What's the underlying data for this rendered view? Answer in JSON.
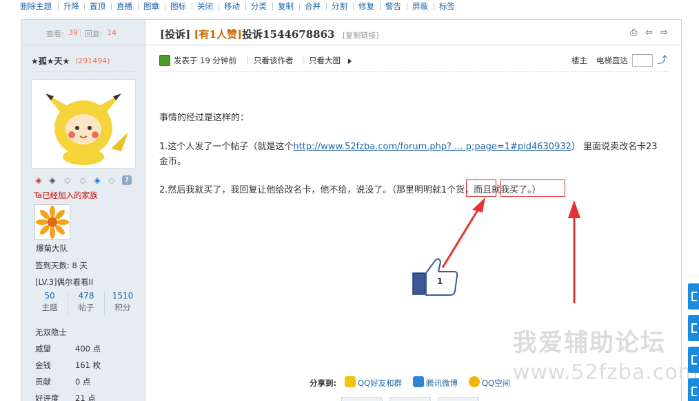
{
  "admin_bar": {
    "items": [
      "删除主题",
      "升降",
      "置顶",
      "直播",
      "图章",
      "图标",
      "关闭",
      "移动",
      "分类",
      "复制",
      "合并",
      "分割",
      "修复",
      "警告",
      "屏蔽",
      "标签"
    ]
  },
  "sidebar": {
    "views_label": "查看:",
    "views_value": "39",
    "replies_label": "回复:",
    "replies_value": "14",
    "author_name": "★孤★天★",
    "author_uid": "(291494)",
    "medals": [
      "medal-icon-red",
      "medal-icon-dark",
      "medal-icon-gray",
      "medal-icon-gray",
      "medal-icon-blue",
      "medal-icon-gray",
      "help-icon"
    ],
    "family_link": "Ta已经加入的家族",
    "family_name": "爆菊大队",
    "checkin_days": "签到天数: 8 天",
    "level": "[LV.3]偶尔看看II",
    "stats": [
      {
        "value": "50",
        "label": "主题"
      },
      {
        "value": "478",
        "label": "帖子"
      },
      {
        "value": "1510",
        "label": "积分"
      }
    ],
    "title": "无双隐士",
    "kv": [
      {
        "label": "威望",
        "value": "400 点"
      },
      {
        "label": "金钱",
        "value": "161 枚"
      },
      {
        "label": "贡献",
        "value": "0 点"
      },
      {
        "label": "好评度",
        "value": "21 点"
      }
    ]
  },
  "post": {
    "category": "[投诉]",
    "badge": "[有1人赞]",
    "title": "投诉1544678863",
    "copy_link": "[复制链接]",
    "meta": {
      "posted": "发表于 19 分钟前",
      "only_author": "只看该作者",
      "big_image": "只看大图",
      "floor_label": "楼主",
      "jump_label": "电梯直达"
    },
    "lines": {
      "intro": "事情的经过是这样的：",
      "line1_prefix": "1.这个人发了一个帖子（就是这个",
      "line1_link": "http://www.52fzba.com/forum.php? ... p;page=1#pid4630932",
      "line1_suffix": "） 里面说卖改名卡23",
      "line1_cont": "金币。",
      "line2": "2.然后我就买了，我回复让他给改名卡，他不给，说没了。（那里明明就1个货，而且就我买了。）"
    },
    "like_count": "1"
  },
  "share": {
    "label": "分享到:",
    "targets": [
      "QQ好友和群",
      "腾讯微博",
      "QQ空间"
    ]
  },
  "watermark": {
    "name": "我爱辅助论坛",
    "url": "www.52fzba.com"
  }
}
